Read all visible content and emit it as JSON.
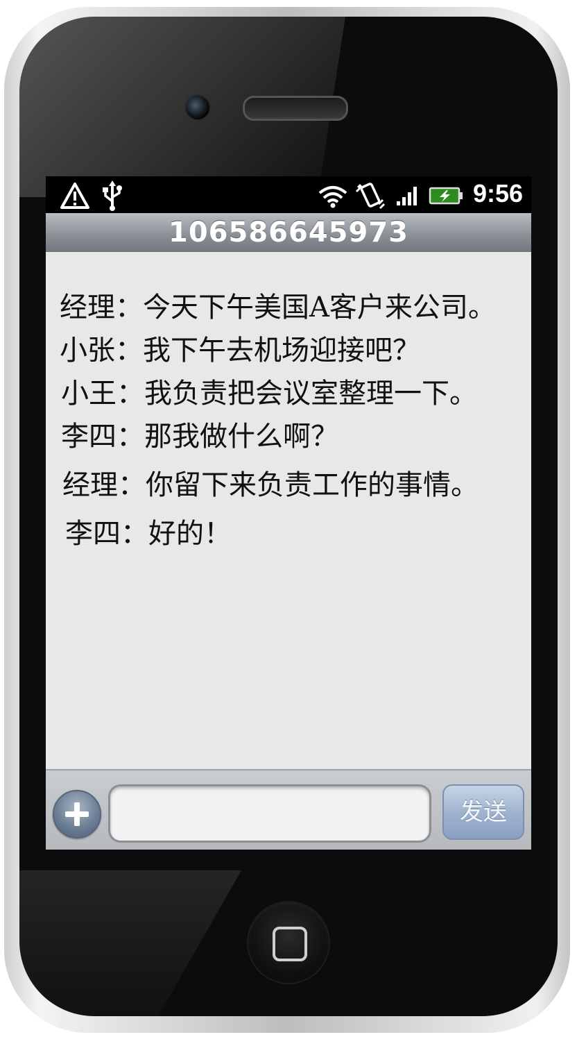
{
  "status_bar": {
    "icons": [
      "warning-icon",
      "usb-icon",
      "wifi-icon",
      "vibrate-icon",
      "signal-icon",
      "battery-charging-icon"
    ],
    "time": "9:56"
  },
  "header": {
    "title": "106586645973"
  },
  "messages": [
    {
      "text": "经理：今天下午美国A客户来公司。"
    },
    {
      "text": "小张：我下午去机场迎接吧？"
    },
    {
      "text": "小王：我负责把会议室整理一下。"
    },
    {
      "text": "李四：那我做什么啊？"
    },
    {
      "text": "经理：你留下来负责工作的事情。"
    },
    {
      "text": "李四：好的！"
    }
  ],
  "composer": {
    "input_value": "",
    "send_label": "发送",
    "attach_icon": "plus-icon"
  },
  "device": {
    "home_icon": "home-square-icon"
  }
}
